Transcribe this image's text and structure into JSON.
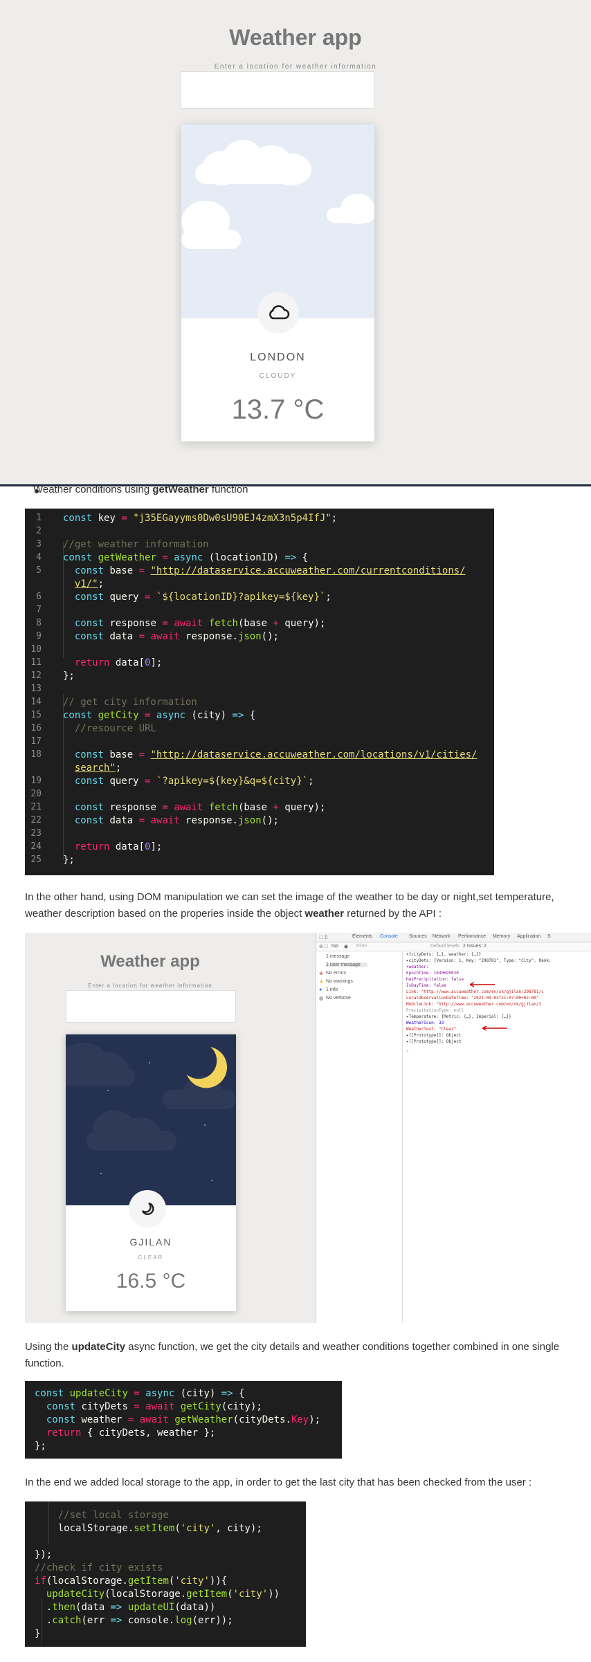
{
  "app": {
    "title": "Weather app",
    "hint": "Enter a location for weather information",
    "city": "LONDON",
    "description": "CLOUDY",
    "temperature": "13.7 °C",
    "icon": "cloud-icon"
  },
  "article": {
    "bullet": "Weather conditions using getWeather function",
    "bullet_pre": "Weather conditions using ",
    "bullet_bold": "getWeather",
    "bullet_post": " function",
    "para1_line1": "In the other hand, using DOM manipulation we can set the image of the weather to be day or night,set temperature,",
    "para1_line2_pre": "weather description based on the properies inside the object ",
    "para1_line2_bold": "weather",
    "para1_line2_post": " returned by the API :",
    "para2_line1_pre": "Using the ",
    "para2_line1_bold": "updateCity",
    "para2_line1_post": " async function, we get the city details and weather conditions together combined in one single",
    "para2_line2": "function.",
    "para3": "In the end we added local storage to the app, in order to get the last city that has been checked from the user :"
  },
  "code1": {
    "line_numbers": [
      "1",
      "2",
      "3",
      "4",
      "5",
      "",
      "6",
      "7",
      "8",
      "9",
      "10",
      "11",
      "12",
      "13",
      "14",
      "15",
      "16",
      "17",
      "18",
      "",
      "19",
      "20",
      "21",
      "22",
      "23",
      "24",
      "25"
    ],
    "lines": [
      "const key = \"j35EGayyms0Dw0sU90EJ4zmX3n5p4IfJ\";",
      "",
      "//get weather information",
      "const getWeather = async (locationID) => {",
      "  const base = \"http://dataservice.accuweather.com/currentconditions/",
      "  v1/\";",
      "  const query = `${locationID}?apikey=${key}`;",
      "",
      "  const response = await fetch(base + query);",
      "  const data = await response.json();",
      "",
      "  return data[0];",
      "};",
      "",
      "// get city information",
      "const getCity = async (city) => {",
      "  //resource URL",
      "",
      "  const base = \"http://dataservice.accuweather.com/locations/v1/cities/",
      "  search\";",
      "  const query = `?apikey=${key}&q=${city}`;",
      "",
      "  const response = await fetch(base + query);",
      "  const data = await response.json();",
      "",
      "  return data[0];",
      "};"
    ]
  },
  "code2": {
    "lines": [
      "const updateCity = async (city) => {",
      "  const cityDets = await getCity(city);",
      "  const weather = await getWeather(cityDets.Key);",
      "  return { cityDets, weather };",
      "};"
    ]
  },
  "code3": {
    "lines": [
      "    //set local storage",
      "    localStorage.setItem('city', city);",
      "",
      "});",
      "//check if city exists",
      "if(localStorage.getItem('city')){",
      "  updateCity(localStorage.getItem('city'))",
      "  .then(data => updateUI(data))",
      "  .catch(err => console.log(err));",
      "}"
    ]
  },
  "screenshot2": {
    "title": "Weather app",
    "hint": "Enter a location for weather information",
    "city": "GJILAN",
    "description": "CLEAR",
    "temperature": "16.5 °C",
    "devtools": {
      "tabs": [
        "Elements",
        "Console",
        "Sources",
        "Network",
        "Performance",
        "Memory",
        "Application",
        "S"
      ],
      "active_tab": "Console",
      "context": "top",
      "filter_placeholder": "Filter",
      "levels": "Default levels",
      "issues": "2 Issues: 2",
      "sidebar": [
        "1 message",
        "1 user message",
        "No errors",
        "No warnings",
        "1 info",
        "No verbose"
      ],
      "console_lines": [
        "▾{cityDets: {…}, weather: {…}}",
        "  ▸cityDets: {Version: 1, Key: \"298781\", Type: \"City\", Rank:",
        "  ▾weather:",
        "     EpochTime: 1630695020",
        "     HasPrecipitation: false",
        "     IsDayTime: false",
        "     Link: \"http://www.accuweather.com/en/xk/gjilan/298781/c",
        "     LocalObservationDateTime: \"2021-09-03T21:07:00+02:00\"",
        "     MobileLink: \"http://www.accuweather.com/en/xk/gjilan/2",
        "     PrecipitationType: null",
        "   ▸Temperature: {Metric: {…}, Imperial: {…}}",
        "     WeatherIcon: 33",
        "     WeatherText: \"Clear\"",
        "   ▸[[Prototype]]: Object",
        "  ▸[[Prototype]]: Object"
      ]
    }
  },
  "colors": {
    "code_bg": "#1e1e1e",
    "keyword": "#66d9ef",
    "function": "#a6e22e",
    "string": "#e6db74",
    "comment": "#75715e",
    "operator": "#f92672",
    "number": "#ae81ff",
    "app_bg": "#eeedeb",
    "night_sky": "#253150",
    "day_sky": "#e6ecf5"
  }
}
